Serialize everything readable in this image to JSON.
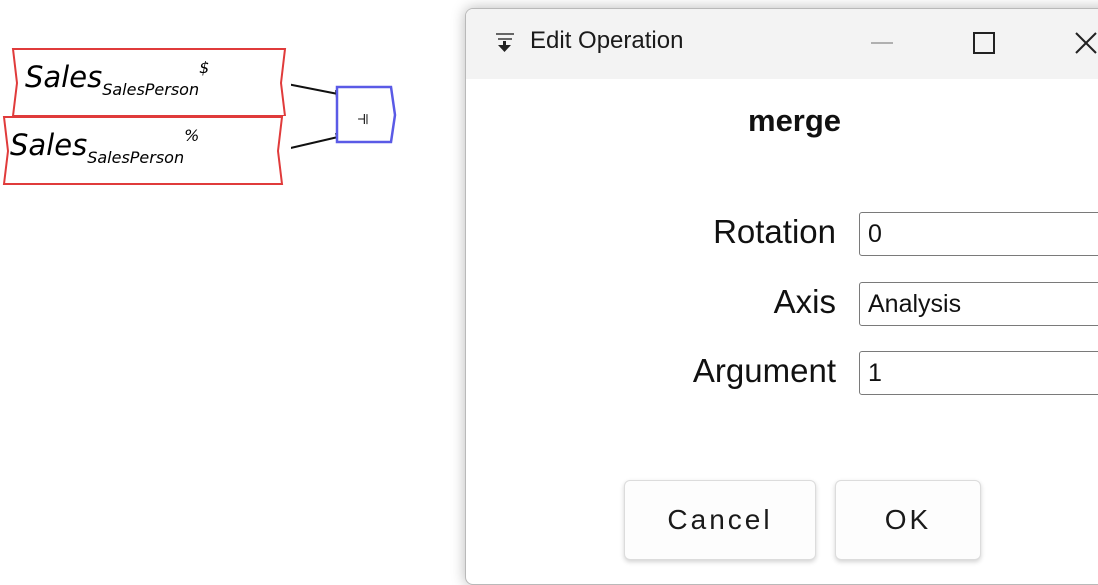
{
  "canvas": {
    "variables": [
      {
        "name": "Sales",
        "subscript": "SalesPerson",
        "superscript": "$"
      },
      {
        "name": "Sales",
        "subscript": "SalesPerson",
        "superscript": "%"
      }
    ],
    "operation_glyph": "⫣",
    "colors": {
      "variable_border": "#e03b3b",
      "operation_border": "#5a5ae6",
      "wire": "#111111"
    }
  },
  "dialog": {
    "title": "Edit Operation",
    "heading": "merge",
    "fields": [
      {
        "label": "Rotation",
        "value": "0"
      },
      {
        "label": "Axis",
        "value": "Analysis"
      },
      {
        "label": "Argument",
        "value": "1"
      }
    ],
    "buttons": {
      "cancel": "Cancel",
      "ok": "OK"
    },
    "icons": {
      "app": "app-icon",
      "minimize": "minimize-icon",
      "maximize": "maximize-icon",
      "close": "close-icon"
    }
  }
}
